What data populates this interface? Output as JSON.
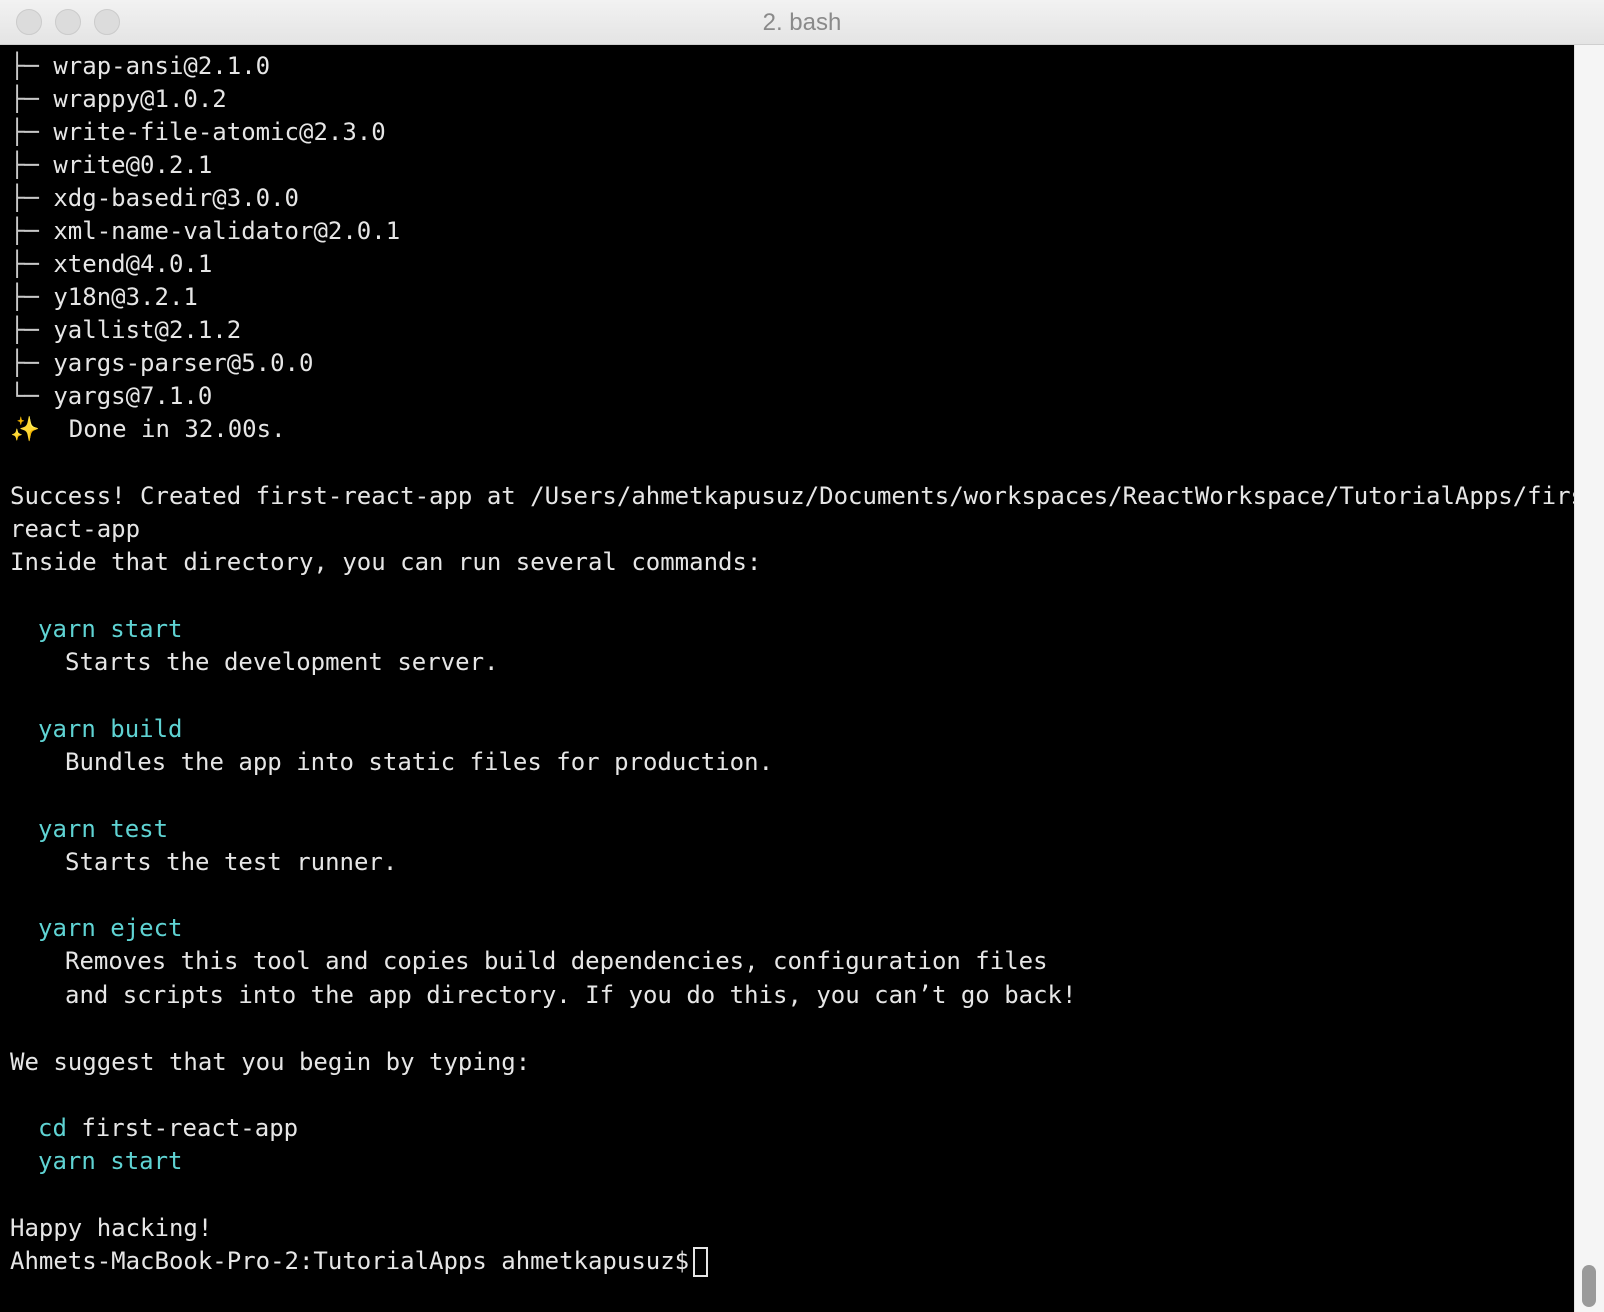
{
  "window": {
    "title": "2. bash"
  },
  "tree_items": [
    "wrap-ansi@2.1.0",
    "wrappy@1.0.2",
    "write-file-atomic@2.3.0",
    "write@0.2.1",
    "xdg-basedir@3.0.0",
    "xml-name-validator@2.0.1",
    "xtend@4.0.1",
    "y18n@3.2.1",
    "yallist@2.1.2",
    "yargs-parser@5.0.0",
    "yargs@7.1.0"
  ],
  "tree_glyphs": {
    "branch": "├─",
    "last": "└─"
  },
  "output": {
    "done": "✨  Done in 32.00s.",
    "success_line1": "Success! Created first-react-app at /Users/ahmetkapusuz/Documents/workspaces/ReactWorkspace/TutorialApps/first-",
    "success_line2": "react-app",
    "inside": "Inside that directory, you can run several commands:",
    "commands": [
      {
        "cmd": "yarn start",
        "desc": [
          "Starts the development server."
        ]
      },
      {
        "cmd": "yarn build",
        "desc": [
          "Bundles the app into static files for production."
        ]
      },
      {
        "cmd": "yarn test",
        "desc": [
          "Starts the test runner."
        ]
      },
      {
        "cmd": "yarn eject",
        "desc": [
          "Removes this tool and copies build dependencies, configuration files",
          "and scripts into the app directory. If you do this, you can’t go back!"
        ]
      }
    ],
    "suggest": "We suggest that you begin by typing:",
    "suggest_cd_keyword": "cd",
    "suggest_cd_arg": "first-react-app",
    "suggest_start": "yarn start",
    "happy": "Happy hacking!",
    "prompt": "Ahmets-MacBook-Pro-2:TutorialApps ahmetkapusuz$"
  },
  "colors": {
    "background": "#000000",
    "text": "#e6e6e6",
    "command": "#5fd3d3"
  }
}
